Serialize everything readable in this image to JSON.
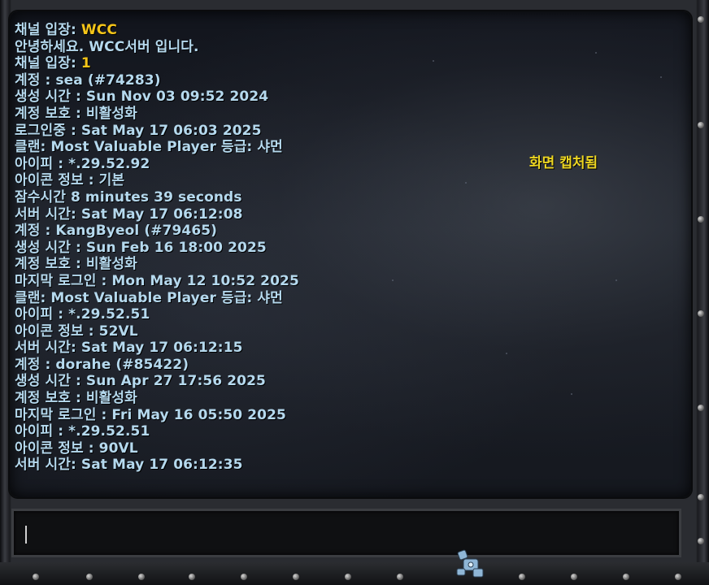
{
  "chat": {
    "lines": [
      {
        "text": "채널 입장: ",
        "highlight": "WCC"
      },
      {
        "text": "안녕하세요. WCC서버 입니다.",
        "highlight": ""
      },
      {
        "text": "채널 입장: ",
        "highlight": "1"
      },
      {
        "text": "계정 : sea (#74283)",
        "highlight": ""
      },
      {
        "text": "생성 시간 : Sun Nov 03 09:52 2024",
        "highlight": ""
      },
      {
        "text": "계정 보호 : 비활성화",
        "highlight": ""
      },
      {
        "text": "로그인중 : Sat May 17 06:03 2025",
        "highlight": ""
      },
      {
        "text": "클랜: Most Valuable Player  등급: 샤먼",
        "highlight": ""
      },
      {
        "text": "아이피 : *.29.52.92",
        "highlight": ""
      },
      {
        "text": "아이콘 정보 : 기본",
        "highlight": ""
      },
      {
        "text": "잠수시간 8 minutes 39 seconds",
        "highlight": ""
      },
      {
        "text": "서버 시간: Sat May 17 06:12:08",
        "highlight": ""
      },
      {
        "text": "계정 : KangByeol (#79465)",
        "highlight": ""
      },
      {
        "text": "생성 시간 : Sun Feb 16 18:00 2025",
        "highlight": ""
      },
      {
        "text": "계정 보호 : 비활성화",
        "highlight": ""
      },
      {
        "text": "마지막 로그인 : Mon May 12 10:52 2025",
        "highlight": ""
      },
      {
        "text": "클랜: Most Valuable Player  등급: 샤먼",
        "highlight": ""
      },
      {
        "text": "아이피 : *.29.52.51",
        "highlight": ""
      },
      {
        "text": "아이콘 정보 : 52VL",
        "highlight": ""
      },
      {
        "text": "서버 시간: Sat May 17 06:12:15",
        "highlight": ""
      },
      {
        "text": "계정 : dorahe (#85422)",
        "highlight": ""
      },
      {
        "text": "생성 시간 : Sun Apr 27 17:56 2025",
        "highlight": ""
      },
      {
        "text": "계정 보호 : 비활성화",
        "highlight": ""
      },
      {
        "text": "마지막 로그인 : Fri May 16 05:50 2025",
        "highlight": ""
      },
      {
        "text": "아이피 : *.29.52.51",
        "highlight": ""
      },
      {
        "text": "아이콘 정보 : 90VL",
        "highlight": ""
      },
      {
        "text": "서버 시간: Sat May 17 06:12:35",
        "highlight": ""
      }
    ]
  },
  "notice": {
    "capture": "화면 캡처됨"
  },
  "input": {
    "value": ""
  },
  "colors": {
    "chat_text": "#b5d9ee",
    "highlight": "#f5c518",
    "notice": "#ecd522"
  }
}
